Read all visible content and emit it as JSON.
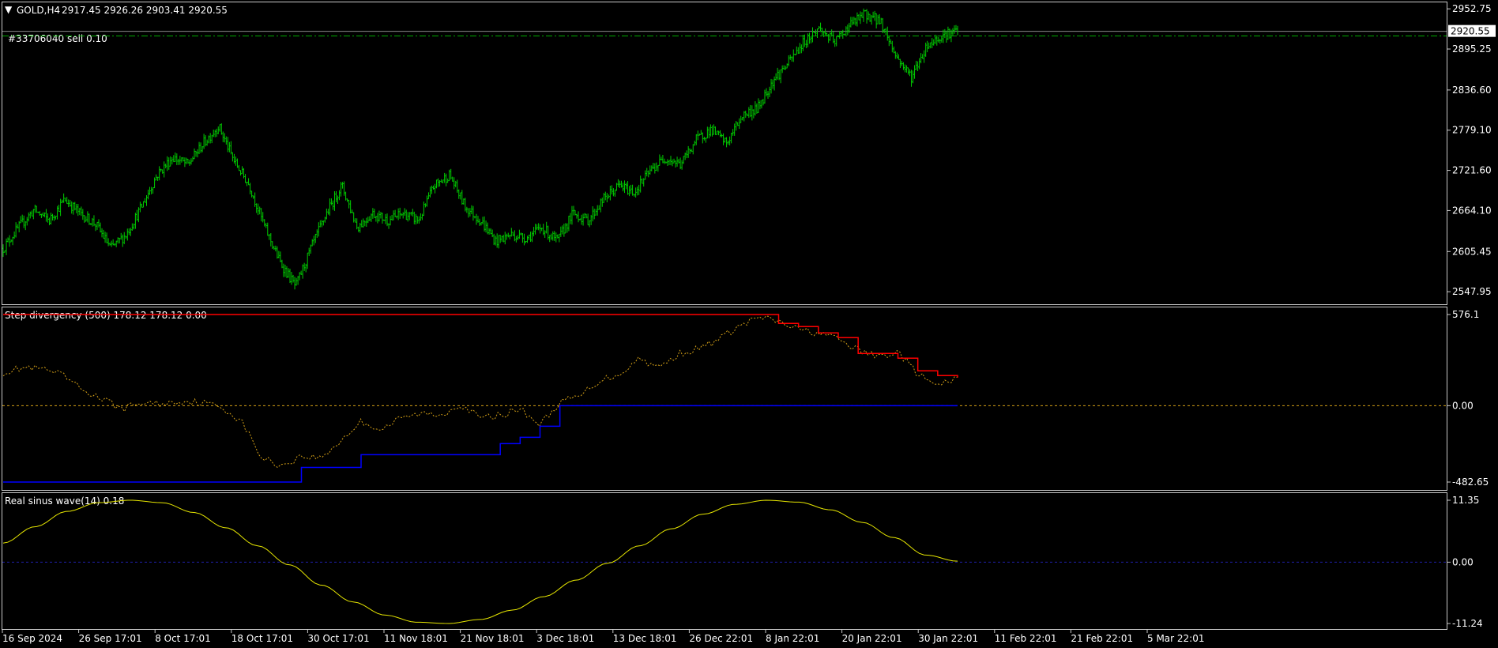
{
  "main": {
    "header": {
      "symbol": "GOLD,H4",
      "ohlc": "2917.45 2926.26 2903.41 2920.55"
    },
    "order_label": "#33706040 sell 0.10",
    "current_price": "2920.55",
    "price_ticks": [
      "2952.75",
      "2895.25",
      "2836.60",
      "2779.10",
      "2721.60",
      "2664.10",
      "2605.45",
      "2547.95"
    ],
    "bull_color": "#00cc00",
    "bear_color": "#00cc00",
    "order_line_color": "#00aa00",
    "price_line_color": "#888888"
  },
  "indicator1": {
    "title": "Step divergency (500) 178.12 178.12 0.00",
    "ticks": [
      "576.1",
      "0.00",
      "-482.65"
    ],
    "upper_color": "#ff0000",
    "lower_color": "#0000ff",
    "dotted_color": "#d4a017",
    "zero_color": "#d4a017"
  },
  "indicator2": {
    "title": "Real sinus wave(14) 0.18",
    "ticks": [
      "11.35",
      "0.00",
      "-11.24"
    ],
    "wave_color": "#e6e600",
    "zero_color": "#2020aa"
  },
  "time_axis": [
    "16 Sep 2024",
    "26 Sep 17:01",
    "8 Oct 17:01",
    "18 Oct 17:01",
    "30 Oct 17:01",
    "11 Nov 18:01",
    "21 Nov 18:01",
    "3 Dec 18:01",
    "13 Dec 18:01",
    "26 Dec 22:01",
    "8 Jan 22:01",
    "20 Jan 22:01",
    "30 Jan 22:01",
    "11 Feb 22:01",
    "21 Feb 22:01",
    "5 Mar 22:01"
  ],
  "chart_data": [
    {
      "type": "bar",
      "series": [
        {
          "name": "GOLD,H4",
          "values": [
            2610,
            2640,
            2665,
            2650,
            2680,
            2660,
            2645,
            2610,
            2630,
            2670,
            2715,
            2740,
            2730,
            2760,
            2785,
            2735,
            2700,
            2640,
            2590,
            2555,
            2610,
            2660,
            2700,
            2640,
            2660,
            2650,
            2660,
            2650,
            2700,
            2715,
            2670,
            2650,
            2620,
            2630,
            2625,
            2640,
            2620,
            2660,
            2650,
            2680,
            2700,
            2690,
            2720,
            2740,
            2730,
            2765,
            2780,
            2760,
            2800,
            2810,
            2850,
            2875,
            2905,
            2925,
            2905,
            2930,
            2945,
            2935,
            2885,
            2855,
            2900,
            2915,
            2920.55
          ]
        }
      ],
      "ylim": [
        2530,
        2962
      ]
    },
    {
      "type": "line",
      "series": [
        {
          "name": "",
          "values": [
            210,
            240,
            230,
            190,
            100,
            40,
            -20,
            20,
            10,
            30,
            20,
            -10,
            -100,
            -330,
            -380,
            -320,
            -330,
            -220,
            -100,
            -150,
            -80,
            -50,
            -60,
            10,
            -80,
            -60,
            -20,
            -120,
            20,
            60,
            160,
            200,
            300,
            240,
            330,
            360,
            420,
            500,
            560,
            530,
            480,
            460,
            420,
            350,
            310,
            340,
            200,
            120,
            178
          ]
        },
        {
          "name": "",
          "values": [
            576.1,
            576.1,
            576.1,
            576.1,
            576.1,
            576.1,
            576.1,
            576.1,
            576.1,
            576.1,
            576.1,
            576.1,
            576.1,
            576.1,
            576.1,
            576.1,
            576.1,
            576.1,
            576.1,
            576.1,
            576.1,
            576.1,
            576.1,
            576.1,
            576.1,
            576.1,
            576.1,
            576.1,
            576.1,
            576.1,
            576.1,
            576.1,
            576.1,
            576.1,
            576.1,
            576.1,
            576.1,
            576.1,
            576.1,
            520,
            500,
            460,
            430,
            330,
            330,
            300,
            220,
            190,
            178.12
          ]
        },
        {
          "name": "",
          "values": [
            -482.65,
            -482.65,
            -482.65,
            -482.65,
            -482.65,
            -482.65,
            -482.65,
            -482.65,
            -482.65,
            -482.65,
            -482.65,
            -482.65,
            -482.65,
            -482.65,
            -482.65,
            -390,
            -390,
            -390,
            -310,
            -310,
            -310,
            -310,
            -310,
            -310,
            -310,
            -240,
            -200,
            -130,
            0,
            0,
            0,
            0,
            0,
            0,
            0,
            0,
            0,
            0,
            0,
            0,
            0,
            0,
            0,
            0,
            0,
            0,
            0,
            0,
            0
          ]
        }
      ],
      "ylim": [
        -482.65,
        576.1
      ]
    },
    {
      "type": "line",
      "series": [
        {
          "name": "Real sinus wave(14)",
          "values": [
            3.5,
            6.5,
            9.3,
            10.9,
            11.35,
            10.9,
            9.1,
            6.3,
            3.0,
            -0.5,
            -4.2,
            -7.3,
            -9.7,
            -11.0,
            -11.24,
            -10.5,
            -8.8,
            -6.3,
            -3.3,
            -0.2,
            3.0,
            6.1,
            8.8,
            10.6,
            11.35,
            11.0,
            9.6,
            7.3,
            4.5,
            1.3,
            0.18
          ]
        }
      ],
      "ylim": [
        -11.24,
        11.35
      ]
    }
  ]
}
